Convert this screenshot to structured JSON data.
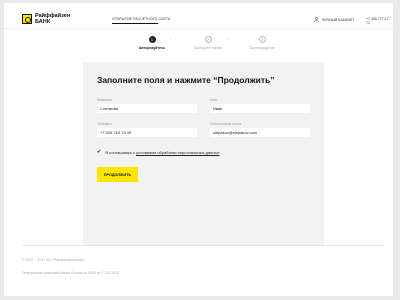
{
  "header": {
    "logo_line1": "Райффайзен",
    "logo_line2": "БАНК",
    "nav_tab": "Открытие расчетного счета",
    "user_label": "Личный кабинет",
    "phone": "+7 495 777-17-71"
  },
  "stepper": {
    "steps": [
      {
        "number": "1",
        "label": "Авторизуйтесь",
        "state": "active"
      },
      {
        "number": "2",
        "label": "Выберите тариф",
        "state": "inactive"
      },
      {
        "number": "3",
        "label": "Подтверждение",
        "state": "inactive"
      }
    ]
  },
  "form": {
    "title": "Заполните поля и нажмите “Продолжить”",
    "fields": {
      "surname": {
        "label": "Фамилия",
        "value": "Слепкова"
      },
      "name": {
        "label": "Имя",
        "value": "Иван"
      },
      "phone": {
        "label": "Телефон",
        "value": "+7 926 763 76 45"
      },
      "email": {
        "label": "Электронная почта",
        "value": "slepakov@slepakov.com"
      }
    },
    "consent_prefix": "Я соглашаюсь с ",
    "consent_link": "условиями обработки персональных данных",
    "consent_checked": true,
    "submit_label": "Продолжить"
  },
  "footer": {
    "copyright": "© 2002 – 2017 АО «Райффайзенбанк»",
    "license": "Генеральная лицензия Банка России № 3292 от 17.02.2015"
  },
  "colors": {
    "accent": "#fee600",
    "card_bg": "#f2f2f2",
    "page_bg": "#e9e9e9"
  }
}
